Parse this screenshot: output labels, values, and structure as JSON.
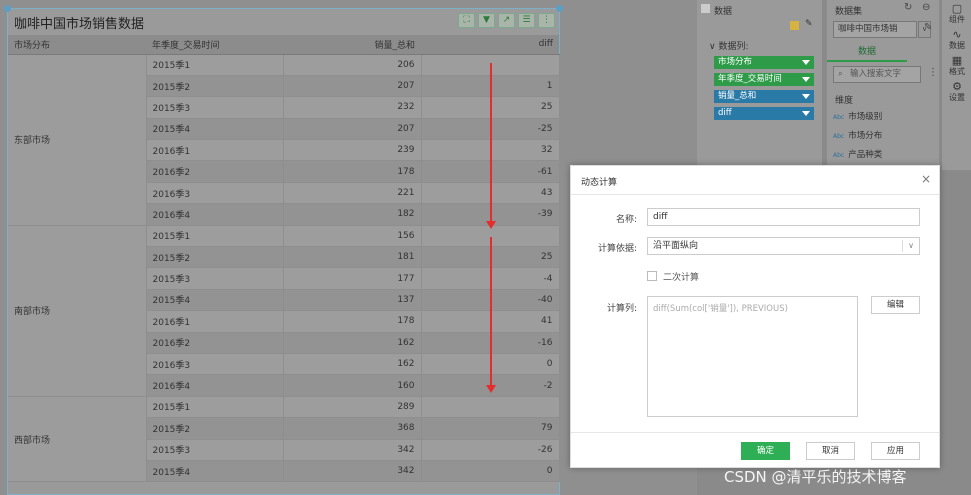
{
  "report": {
    "title": "咖啡中国市场销售数据",
    "columns": [
      "市场分布",
      "年季度_交易时间",
      "销量_总和",
      "diff"
    ],
    "rows": [
      {
        "region": "东部市场",
        "q": "2015季1",
        "sales": "206",
        "diff": ""
      },
      {
        "region": "",
        "q": "2015季2",
        "sales": "207",
        "diff": "1"
      },
      {
        "region": "",
        "q": "2015季3",
        "sales": "232",
        "diff": "25"
      },
      {
        "region": "",
        "q": "2015季4",
        "sales": "207",
        "diff": "-25"
      },
      {
        "region": "",
        "q": "2016季1",
        "sales": "239",
        "diff": "32"
      },
      {
        "region": "",
        "q": "2016季2",
        "sales": "178",
        "diff": "-61"
      },
      {
        "region": "",
        "q": "2016季3",
        "sales": "221",
        "diff": "43"
      },
      {
        "region": "",
        "q": "2016季4",
        "sales": "182",
        "diff": "-39"
      },
      {
        "region": "南部市场",
        "q": "2015季1",
        "sales": "156",
        "diff": ""
      },
      {
        "region": "",
        "q": "2015季2",
        "sales": "181",
        "diff": "25"
      },
      {
        "region": "",
        "q": "2015季3",
        "sales": "177",
        "diff": "-4"
      },
      {
        "region": "",
        "q": "2015季4",
        "sales": "137",
        "diff": "-40"
      },
      {
        "region": "",
        "q": "2016季1",
        "sales": "178",
        "diff": "41"
      },
      {
        "region": "",
        "q": "2016季2",
        "sales": "162",
        "diff": "-16"
      },
      {
        "region": "",
        "q": "2016季3",
        "sales": "162",
        "diff": "0"
      },
      {
        "region": "",
        "q": "2016季4",
        "sales": "160",
        "diff": "-2"
      },
      {
        "region": "西部市场",
        "q": "2015季1",
        "sales": "289",
        "diff": ""
      },
      {
        "region": "",
        "q": "2015季2",
        "sales": "368",
        "diff": "79"
      },
      {
        "region": "",
        "q": "2015季3",
        "sales": "342",
        "diff": "-26"
      },
      {
        "region": "",
        "q": "2015季4",
        "sales": "342",
        "diff": "0"
      }
    ]
  },
  "fields_panel": {
    "data_header": "数据",
    "columns_header": "数据列:",
    "fields": [
      {
        "label": "市场分布",
        "color": "green"
      },
      {
        "label": "年季度_交易时间",
        "color": "green"
      },
      {
        "label": "销量_总和",
        "color": "blue"
      },
      {
        "label": "diff",
        "color": "blue"
      }
    ]
  },
  "dataset_panel": {
    "header": "数据集",
    "dataset_name": "咖啡中国市场销",
    "tab": "数据",
    "search_placeholder": "输入搜索文字",
    "dimension_header": "维度",
    "dimensions": [
      "市场级别",
      "市场分布",
      "产品种类"
    ],
    "abc_tag": "Abc"
  },
  "side_rail": [
    {
      "label": "组件",
      "icon": "component-icon"
    },
    {
      "label": "数据",
      "icon": "data-icon"
    },
    {
      "label": "格式",
      "icon": "format-icon"
    },
    {
      "label": "设置",
      "icon": "settings-icon"
    }
  ],
  "dialog": {
    "title": "动态计算",
    "close": "×",
    "name_label": "名称:",
    "name_value": "diff",
    "basis_label": "计算依据:",
    "basis_value": "沿平面纵向",
    "secondary_label": "二次计算",
    "calc_col_label": "计算列:",
    "formula": "diff(Sum(col['销量']), PREVIOUS)",
    "edit_button": "编辑",
    "ok_button": "确定",
    "cancel_button": "取消",
    "apply_button": "应用"
  },
  "watermark": "CSDN @清平乐的技术博客",
  "colors": {
    "ok": "#2eaf55",
    "field_green": "#2e9b49",
    "field_blue": "#2a7aa8",
    "arrow": "#e52d2d"
  }
}
